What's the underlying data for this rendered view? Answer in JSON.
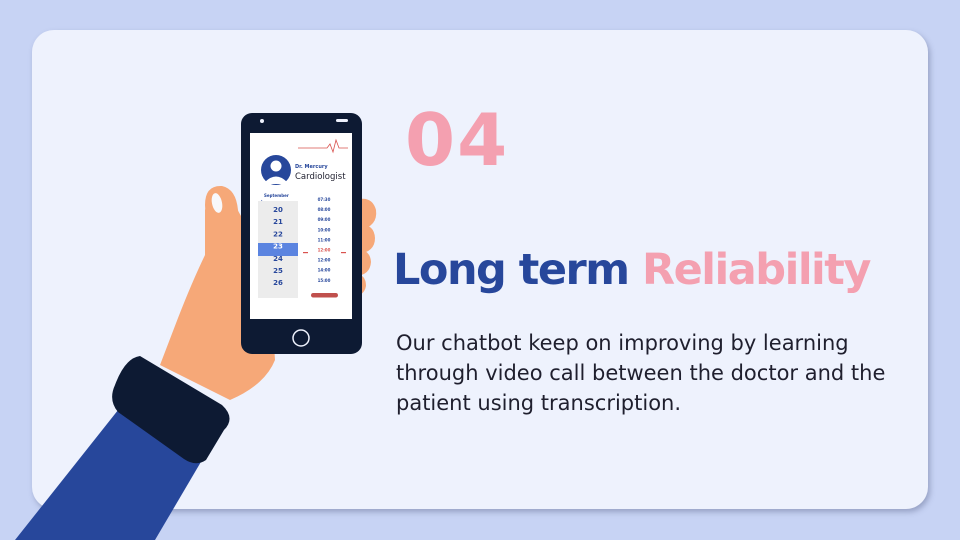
{
  "slide": {
    "number": "04",
    "title_part1": "Long term",
    "title_part2": "Reliability",
    "body": "Our chatbot keep on improving by learning through video call between the doctor and the patient using transcription."
  },
  "phone": {
    "doctor_name": "Dr. Mercury",
    "doctor_role": "Cardiologist",
    "month": "September",
    "dates": [
      "20",
      "21",
      "22",
      "23",
      "24",
      "25",
      "26"
    ],
    "selected_date": "23",
    "times": [
      "07:30",
      "08:00",
      "09:00",
      "10:00",
      "11:00",
      "12:00",
      "12:00",
      "14:00",
      "15:00"
    ],
    "selected_time": "12:00"
  },
  "colors": {
    "background": "#c7d3f4",
    "card": "#eef2fd",
    "accent_blue": "#27479b",
    "accent_pink": "#f4a0b0",
    "sleeve": "#27479b",
    "skin": "#f6a878",
    "phone_body": "#0d1a33",
    "selected": "#5b84e0",
    "alert_red": "#d9534f"
  }
}
